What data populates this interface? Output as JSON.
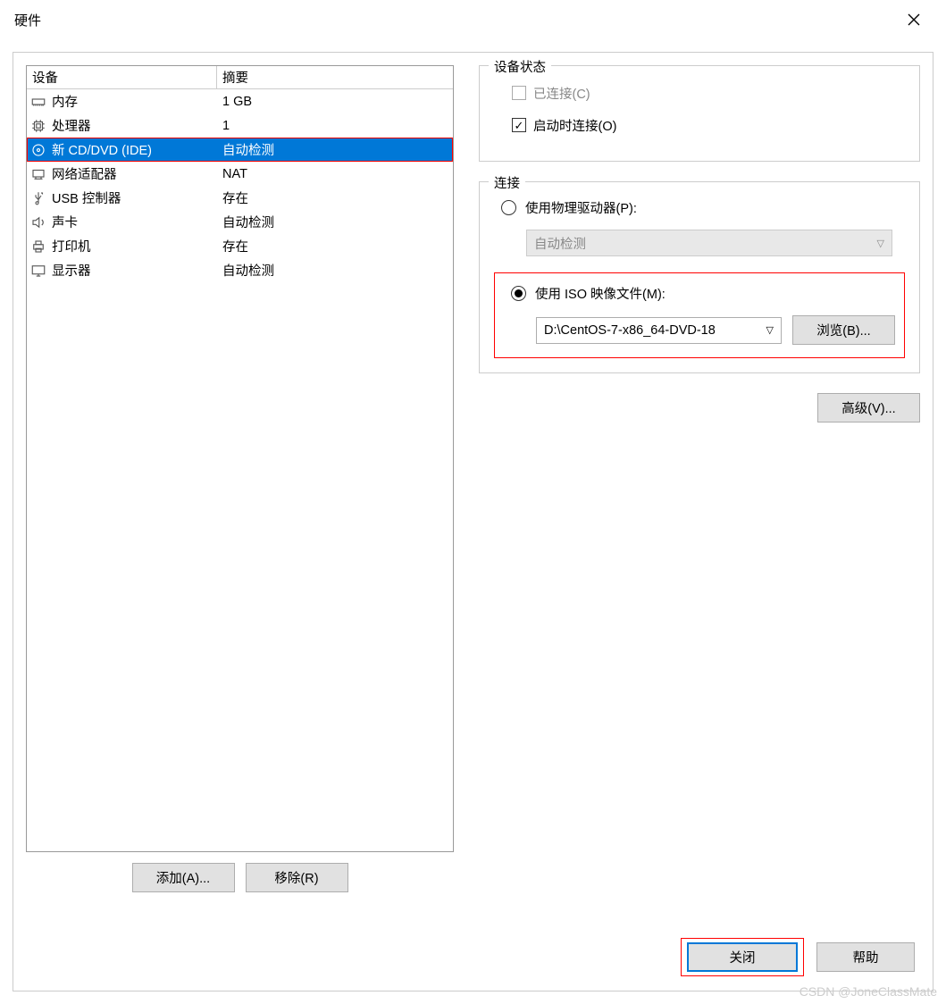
{
  "window": {
    "title": "硬件"
  },
  "device_list": {
    "header": {
      "col1": "设备",
      "col2": "摘要"
    },
    "rows": [
      {
        "icon": "memory",
        "name": "内存",
        "summary": "1 GB"
      },
      {
        "icon": "cpu",
        "name": "处理器",
        "summary": "1"
      },
      {
        "icon": "disc",
        "name": "新 CD/DVD (IDE)",
        "summary": "自动检测",
        "selected": true
      },
      {
        "icon": "nic",
        "name": "网络适配器",
        "summary": "NAT"
      },
      {
        "icon": "usb",
        "name": "USB 控制器",
        "summary": "存在"
      },
      {
        "icon": "sound",
        "name": "声卡",
        "summary": "自动检测"
      },
      {
        "icon": "printer",
        "name": "打印机",
        "summary": "存在"
      },
      {
        "icon": "display",
        "name": "显示器",
        "summary": "自动检测"
      }
    ]
  },
  "buttons": {
    "add": "添加(A)...",
    "remove": "移除(R)",
    "browse": "浏览(B)...",
    "advanced": "高级(V)...",
    "close": "关闭",
    "help": "帮助"
  },
  "device_state": {
    "legend": "设备状态",
    "connected": "已连接(C)",
    "connect_at_power_on": "启动时连接(O)"
  },
  "connection": {
    "legend": "连接",
    "physical": "使用物理驱动器(P):",
    "physical_value": "自动检测",
    "iso": "使用 ISO 映像文件(M):",
    "iso_path": "D:\\CentOS-7-x86_64-DVD-18"
  },
  "watermark": "CSDN @JoneClassMate"
}
